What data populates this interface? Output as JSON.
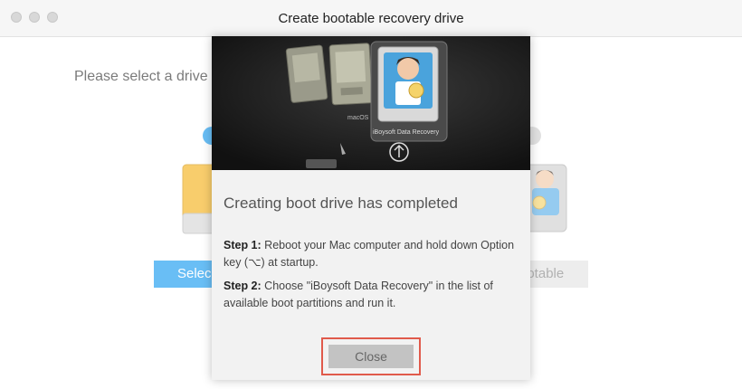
{
  "window": {
    "title": "Create bootable recovery drive"
  },
  "main": {
    "instruction": "Please select a drive t",
    "select_button_label": "Selec",
    "bootable_button_label": "ootable"
  },
  "dialog": {
    "heading": "Creating boot drive has completed",
    "hero_labels": {
      "drive_1": "macOS",
      "drive_2": "iBoysoft Data Recovery"
    },
    "step1_label": "Step 1:",
    "step1_text": " Reboot your Mac computer and hold down Option key (⌥) at startup.",
    "step2_label": "Step 2:",
    "step2_text": " Choose \"iBoysoft Data Recovery\" in the list of available boot partitions and run it.",
    "close_label": "Close"
  },
  "colors": {
    "accent": "#1a9cf0",
    "highlight": "#e05a4b",
    "drive": "#f5b21e"
  },
  "icons": [
    "close-dot-icon",
    "minimize-dot-icon",
    "zoom-dot-icon",
    "drive-icon",
    "avatar-drive-icon",
    "up-arrow-icon"
  ]
}
